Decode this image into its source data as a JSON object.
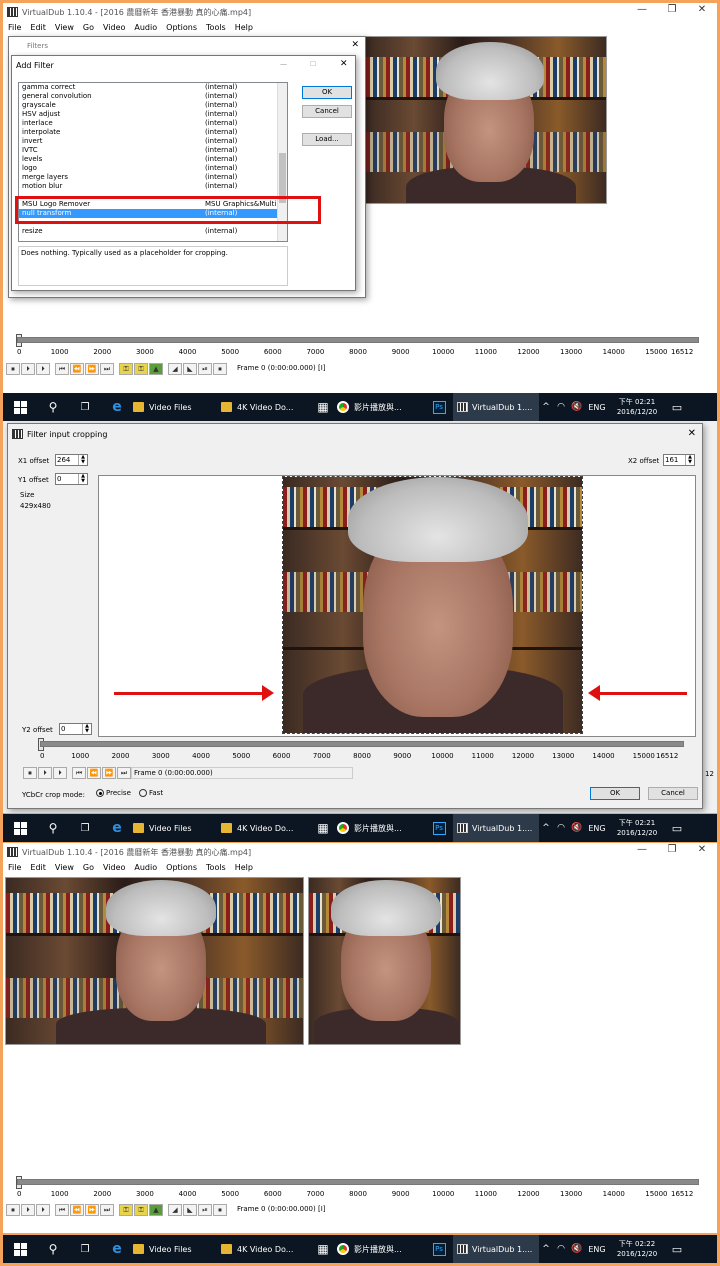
{
  "panel1": {
    "title": "VirtualDub 1.10.4 - [2016 農曆新年 香港暴動 真的心痛.mp4]",
    "window_controls": [
      "—",
      "❐",
      "✕"
    ],
    "menu": [
      "File",
      "Edit",
      "View",
      "Go",
      "Video",
      "Audio",
      "Options",
      "Tools",
      "Help"
    ],
    "filters_dialog": {
      "title": "Filters",
      "close": "✕"
    },
    "add_filter": {
      "title": "Add Filter",
      "controls": [
        "—",
        "☐",
        "✕"
      ],
      "items": [
        {
          "name": "gamma correct",
          "source": "(internal)"
        },
        {
          "name": "general convolution",
          "source": "(internal)"
        },
        {
          "name": "grayscale",
          "source": "(internal)"
        },
        {
          "name": "HSV adjust",
          "source": "(internal)"
        },
        {
          "name": "interlace",
          "source": "(internal)"
        },
        {
          "name": "interpolate",
          "source": "(internal)"
        },
        {
          "name": "invert",
          "source": "(internal)"
        },
        {
          "name": "IVTC",
          "source": "(internal)"
        },
        {
          "name": "levels",
          "source": "(internal)"
        },
        {
          "name": "logo",
          "source": "(internal)"
        },
        {
          "name": "merge layers",
          "source": "(internal)"
        },
        {
          "name": "motion blur",
          "source": "(internal)"
        },
        {
          "name": "MSU Logo Remover",
          "source": "MSU Graphics&Multime"
        },
        {
          "name": "null transform",
          "source": "(internal)"
        },
        {
          "name": "resize",
          "source": "(internal)"
        }
      ],
      "selected_index": 13,
      "ok": "OK",
      "cancel": "Cancel",
      "load": "Load...",
      "description": "Does nothing. Typically used as a placeholder for cropping."
    },
    "timeline_ticks": [
      "0",
      "1000",
      "2000",
      "3000",
      "4000",
      "5000",
      "6000",
      "7000",
      "8000",
      "9000",
      "10000",
      "11000",
      "12000",
      "13000",
      "14000",
      "15000",
      "16512"
    ],
    "frame_status": "Frame 0 (0:00:00.000) [I]"
  },
  "taskbar1": {
    "apps": [
      "Video Files",
      "4K Video Do...",
      "影片播放與...",
      "VirtualDub 1...."
    ],
    "lang": "ENG",
    "time": "下午 02:21",
    "date": "2016/12/20"
  },
  "panel2": {
    "title": "Filter input cropping",
    "close": "✕",
    "x1_label": "X1 offset",
    "x1_value": "264",
    "y1_label": "Y1 offset",
    "y1_value": "0",
    "x2_label": "X2 offset",
    "x2_value": "161",
    "y2_label": "Y2 offset",
    "y2_value": "0",
    "size_label": "Size",
    "size_value": "429x480",
    "timeline_ticks": [
      "0",
      "1000",
      "2000",
      "3000",
      "4000",
      "5000",
      "6000",
      "7000",
      "8000",
      "9000",
      "10000",
      "11000",
      "12000",
      "13000",
      "14000",
      "15000",
      "16512"
    ],
    "frame_status": "Frame 0 (0:00:00.000)",
    "crop_mode_label": "YCbCr crop mode:",
    "precise": "Precise",
    "fast": "Fast",
    "ok": "OK",
    "cancel": "Cancel",
    "edge_label": "12"
  },
  "taskbar2": {
    "apps": [
      "Video Files",
      "4K Video Do...",
      "影片播放與...",
      "VirtualDub 1...."
    ],
    "lang": "ENG",
    "time": "下午 02:21",
    "date": "2016/12/20"
  },
  "panel3": {
    "title": "VirtualDub 1.10.4 - [2016 農曆新年 香港暴動 真的心痛.mp4]",
    "window_controls": [
      "—",
      "❐",
      "✕"
    ],
    "menu": [
      "File",
      "Edit",
      "View",
      "Go",
      "Video",
      "Audio",
      "Options",
      "Tools",
      "Help"
    ],
    "timeline_ticks": [
      "0",
      "1000",
      "2000",
      "3000",
      "4000",
      "5000",
      "6000",
      "7000",
      "8000",
      "9000",
      "10000",
      "11000",
      "12000",
      "13000",
      "14000",
      "15000",
      "16512"
    ],
    "frame_status": "Frame 0 (0:00:00.000) [I]"
  },
  "taskbar3": {
    "apps": [
      "Video Files",
      "4K Video Do...",
      "影片播放與...",
      "VirtualDub 1...."
    ],
    "lang": "ENG",
    "time": "下午 02:22",
    "date": "2016/12/20"
  },
  "colors": {
    "frame": "#f5a25b",
    "taskbar": "#0c1622",
    "selection": "#3399ff",
    "highlight_box": "#e01010"
  }
}
